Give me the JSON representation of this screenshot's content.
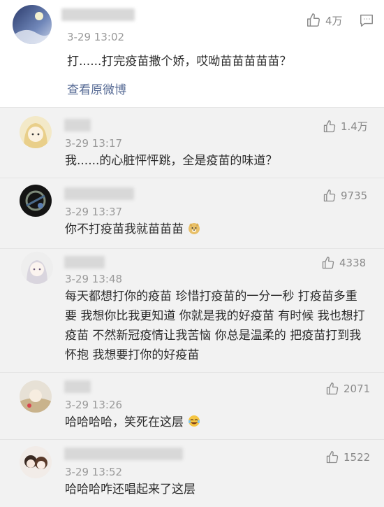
{
  "comments": [
    {
      "time": "3-29 13:02",
      "text": "打......打完疫苗撒个娇，哎呦苗苗苗苗苗？",
      "likes": "4万",
      "link": "查看原微博"
    },
    {
      "time": "3-29 13:17",
      "text": "我......的心脏怦怦跳，全是疫苗的味道？",
      "likes": "1.4万"
    },
    {
      "time": "3-29 13:37",
      "text": "你不打疫苗我就苗苗苗",
      "likes": "9735"
    },
    {
      "time": "3-29 13:48",
      "text": "每天都想打你的疫苗 珍惜打疫苗的一分一秒 打疫苗多重要 我想你比我更知道 你就是我的好疫苗 有时候 我也想打疫苗 不然新冠疫情让我苦恼 你总是温柔的 把疫苗打到我怀抱 我想要打你的好疫苗",
      "likes": "4338"
    },
    {
      "time": "3-29 13:26",
      "text": "哈哈哈哈，笑死在这层",
      "likes": "2071"
    },
    {
      "time": "3-29 13:52",
      "text": "哈哈哈咋还唱起来了这层",
      "likes": "1522"
    }
  ],
  "icons": {
    "like": "thumbs-up-icon",
    "comment": "comment-icon"
  },
  "colors": {
    "link": "#576b95",
    "time": "#9a9a9a",
    "background": "#f2f2f2"
  }
}
